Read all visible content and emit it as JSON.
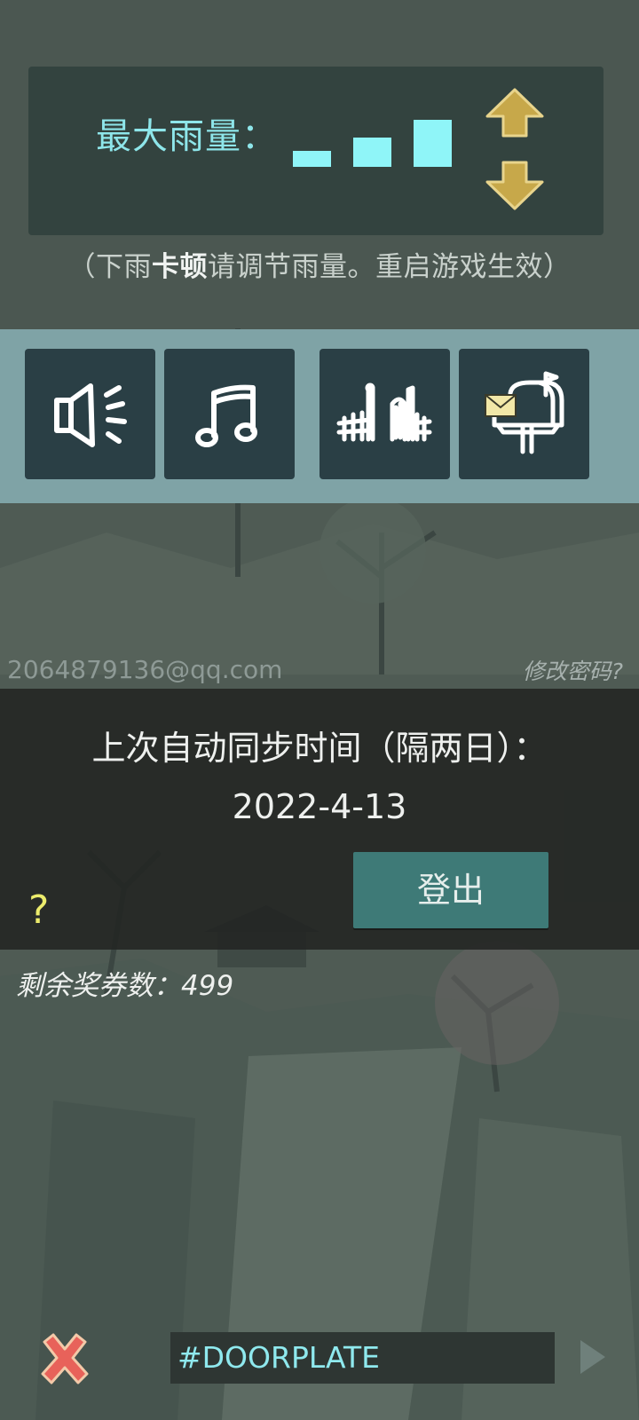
{
  "rain": {
    "label": "最大雨量：",
    "levels": 3,
    "up_icon": "arrow-up-icon",
    "down_icon": "arrow-down-icon",
    "hint_before": "（下雨",
    "hint_bold": "卡顿",
    "hint_after": "请调节雨量。重启游戏生效）"
  },
  "toolbar": {
    "items": [
      {
        "icon": "sound-icon"
      },
      {
        "icon": "music-icon"
      },
      {
        "icon": "fence-gate-icon"
      },
      {
        "icon": "mailbox-icon"
      }
    ]
  },
  "account": {
    "email": "2064879136@qq.com",
    "change_password": "修改密码?"
  },
  "sync": {
    "title": "上次自动同步时间（隔两日）：",
    "date": "2022-4-13",
    "logout_label": "登出",
    "help_label": "?"
  },
  "tickets": {
    "label": "剩余奖券数：",
    "count": "499"
  },
  "bottom": {
    "input_value": "#DOORPLATE",
    "close_icon": "close-icon",
    "send_icon": "send-arrow-icon"
  },
  "colors": {
    "accent_cyan": "#8ff5f8",
    "gold": "#c7a84a",
    "logout_bg": "#3e7a77",
    "help_yellow": "#ecec6c",
    "close_red": "#e8625a"
  }
}
